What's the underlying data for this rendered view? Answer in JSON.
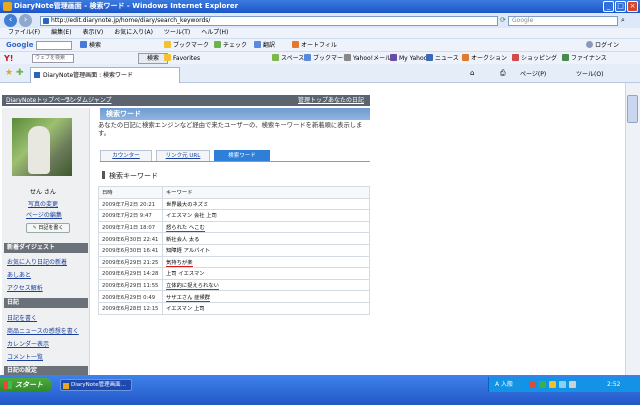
{
  "window": {
    "title": "DiaryNote管理画面 - 検索ワード - Windows Internet Explorer"
  },
  "address": {
    "url": "http://edit.diarynote.jp/home/diary/search_keywords/",
    "search_placeholder": "Google"
  },
  "menu": {
    "items": [
      "ファイル(F)",
      "編集(E)",
      "表示(V)",
      "お気に入り(A)",
      "ツール(T)",
      "ヘルプ(H)"
    ]
  },
  "google_toolbar": {
    "label": "Google",
    "search": "検索",
    "bookmark": "ブックマーク",
    "check": "チェック",
    "translate": "翻訳",
    "autofill": "オートフィル",
    "login": "ログイン"
  },
  "yahoo_toolbar": {
    "label": "Y!",
    "search_placeholder": "ウェブを検索",
    "search_button": "検索",
    "favorites": "Favorites",
    "bookmark": "ブックマーク",
    "yahoo_mail": "Yahoo!メール",
    "my_yahoo": "My Yahoo!",
    "news": "ニュース",
    "auction": "オークション",
    "shopping": "ショッピング",
    "finance": "ファイナンス",
    "space": "スペース"
  },
  "tab": {
    "label": "DiaryNote管理画面 : 検索ワード",
    "page_menu": "ページ(P)",
    "tools_menu": "ツール(O)"
  },
  "page_header": {
    "home_link": "DiaryNoteトップページ",
    "random_link": "ランダムジャンプ",
    "admin_link": "管理トップ",
    "diary_link": "あなたの日記"
  },
  "profile": {
    "name": "せん さん",
    "photo_change": "写真の変更",
    "page_settings": "ページの編集",
    "write_button": "日記を書く"
  },
  "sidebar": {
    "section1": "新着ダイジェスト",
    "section1_links": [
      "お気に入り日記の新着",
      "あしあと",
      "アクセス解析"
    ],
    "section2": "日記",
    "section2_links": [
      "日記を書く",
      "商品ニュースの感想を書く",
      "カレンダー表示",
      "コメント一覧"
    ],
    "section3": "日記の設定"
  },
  "main": {
    "title": "検索ワード",
    "description": "あなたの日記に検索エンジンなど経由で来たユーザーの、検索キーワードを新着順に表示します。",
    "tabs": [
      "カウンター",
      "リンク元 URL",
      "検索ワード"
    ],
    "subtitle": "検索キーワード",
    "table_headers": [
      "日時",
      "キーワード"
    ],
    "rows": [
      {
        "date": "2009年7月2日 20:21",
        "keyword": "世界最大のネズミ"
      },
      {
        "date": "2009年7月2日 9:47",
        "keyword": "イエスマン 会社 上司"
      },
      {
        "date": "2009年7月1日 18:07",
        "keyword": "怒られた へこむ"
      },
      {
        "date": "2009年6月30日 22:41",
        "keyword": "新社会人 太る"
      },
      {
        "date": "2009年6月30日 16:41",
        "keyword": "知障経 アルバイト"
      },
      {
        "date": "2009年6月29日 21:25",
        "keyword": "気持ちが楽"
      },
      {
        "date": "2009年6月29日 14:28",
        "keyword": "上司 イエスマン"
      },
      {
        "date": "2009年6月29日 11:55",
        "keyword": "立体的に捉えられない"
      },
      {
        "date": "2009年6月29日 0:49",
        "keyword": "サザエさん 症候群"
      },
      {
        "date": "2009年6月28日 12:15",
        "keyword": "イエスマン 上司"
      }
    ]
  },
  "taskbar": {
    "start": "スタート",
    "task_item": "DiaryNote管理画面...",
    "ime": "A 入般",
    "clock": "2:52"
  },
  "colors": {
    "underline": "#d41a1a",
    "active_tab": "#2f7fd8",
    "section_header": "#6b7178"
  }
}
